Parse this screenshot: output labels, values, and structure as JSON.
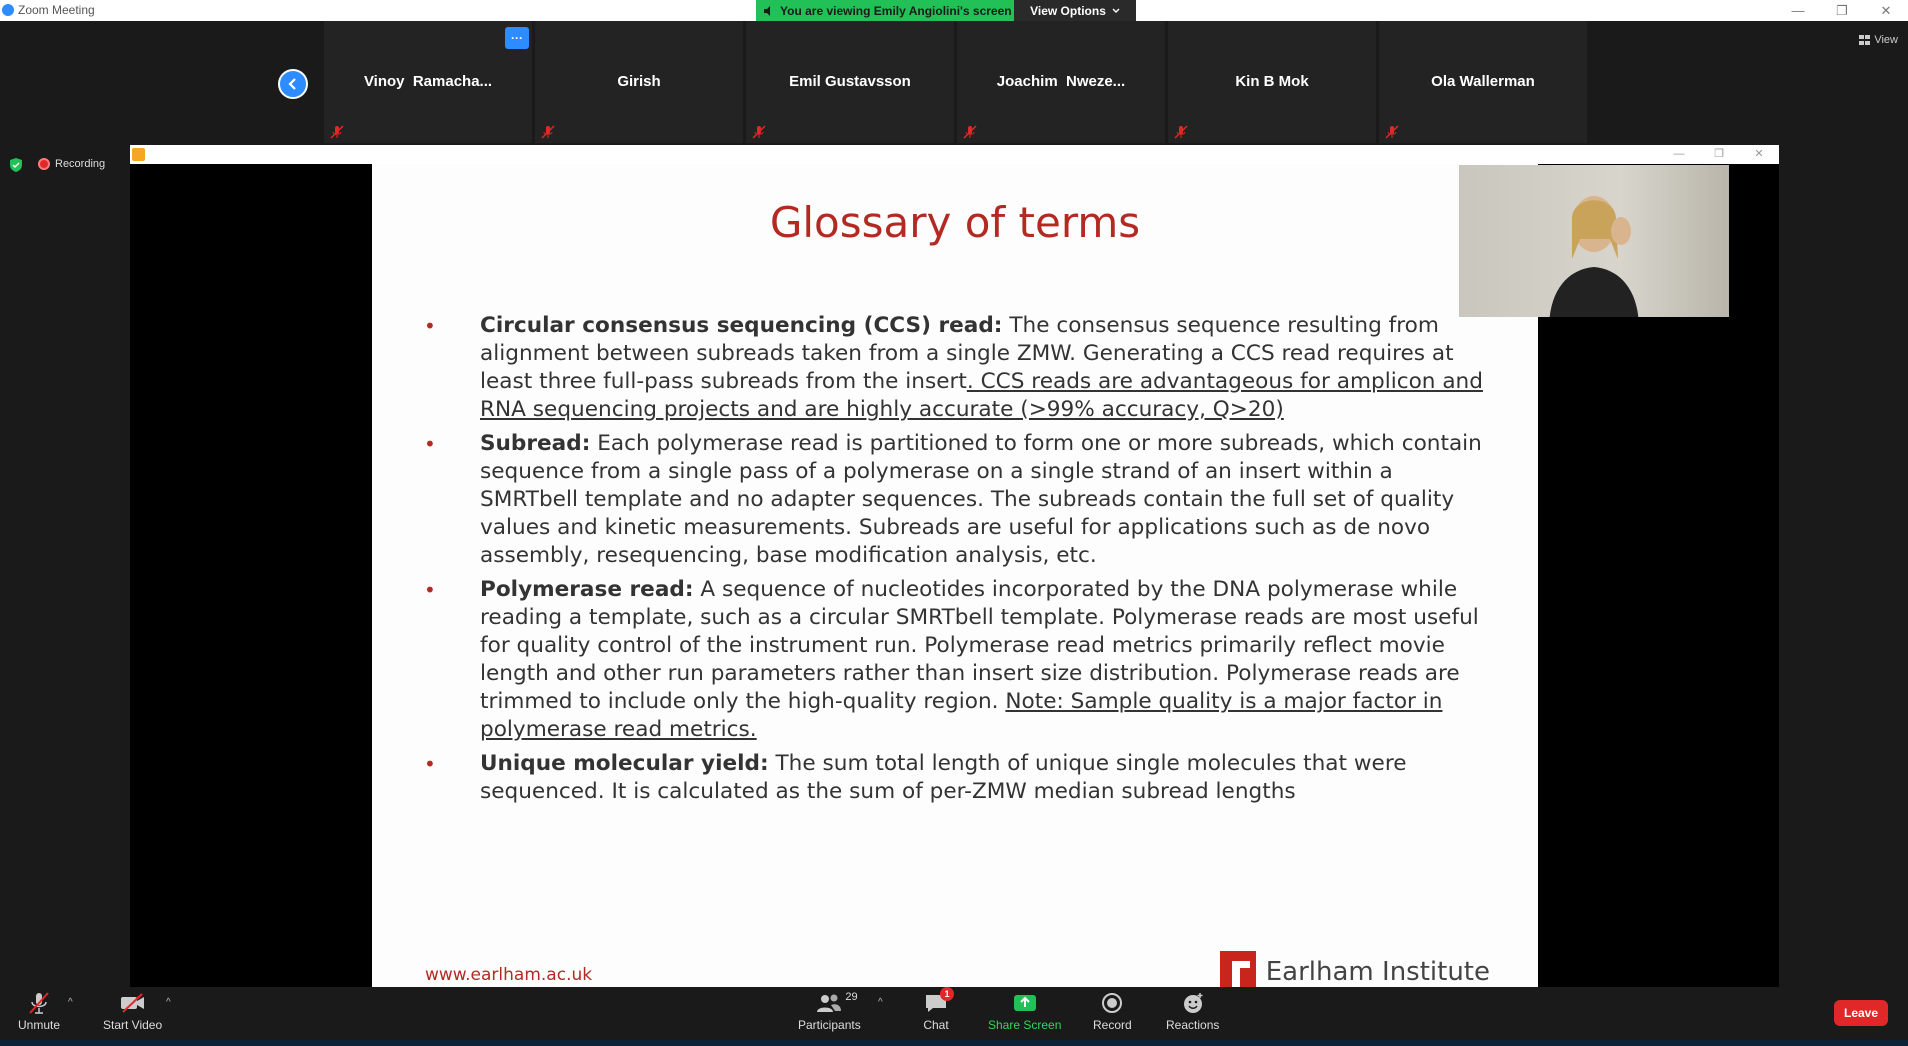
{
  "window": {
    "title": "Zoom Meeting",
    "viewing_banner": "You are viewing Emily Angiolini's screen",
    "view_options": "View Options",
    "minimize": "—",
    "restore": "❐",
    "close": "✕"
  },
  "gallery": {
    "view_label": "View",
    "participants": [
      {
        "name": "Vinoy  Ramacha..."
      },
      {
        "name": "Girish"
      },
      {
        "name": "Emil Gustavsson"
      },
      {
        "name": "Joachim  Nweze..."
      },
      {
        "name": "Kin B Mok"
      },
      {
        "name": "Ola Wallerman"
      }
    ],
    "more_label": "···"
  },
  "status": {
    "recording": "Recording"
  },
  "slide": {
    "title": "Glossary of terms",
    "bullets": [
      {
        "term": "Circular consensus sequencing (CCS) read:",
        "text": " The consensus sequence resulting from alignment between subreads taken from a single ZMW. Generating a CCS read requires at least three full-pass subreads from the insert",
        "underlined": ". CCS reads are advantageous for amplicon and RNA sequencing projects and are highly accurate (>99% accuracy, Q>20)"
      },
      {
        "term": "Subread:",
        "text": " Each polymerase read is partitioned to form one or more subreads, which contain sequence from a single pass of a polymerase on a single strand of an insert within a SMRTbell template and no adapter sequences. The subreads contain the full set of quality values and kinetic measurements. Subreads are useful for applications such as de novo assembly, resequencing, base modification analysis, etc.",
        "underlined": ""
      },
      {
        "term": "Polymerase read:",
        "text": " A sequence of nucleotides incorporated by the DNA polymerase while reading a template, such as a circular SMRTbell template. Polymerase reads are most useful for quality control of the instrument run. Polymerase read metrics primarily reflect movie length and other run parameters rather than insert size distribution. Polymerase reads are trimmed to include only the high-quality region. ",
        "underlined": "Note: Sample quality is a major factor in polymerase read metrics."
      },
      {
        "term": "Unique molecular yield:",
        "text": " The sum total length of unique single molecules that were sequenced. It is calculated as the sum of per-ZMW median subread lengths",
        "underlined": ""
      }
    ],
    "url": "www.earlham.ac.uk",
    "logo_text": "Earlham Institute"
  },
  "toolbar": {
    "unmute": "Unmute",
    "start_video": "Start Video",
    "participants": "Participants",
    "participants_count": "29",
    "chat": "Chat",
    "chat_badge": "1",
    "share_screen": "Share Screen",
    "record": "Record",
    "reactions": "Reactions",
    "leave": "Leave"
  },
  "colors": {
    "zoom_blue": "#2d8cff",
    "banner_green": "#21c157",
    "slide_red": "#b22a22",
    "leave_red": "#e02828"
  }
}
